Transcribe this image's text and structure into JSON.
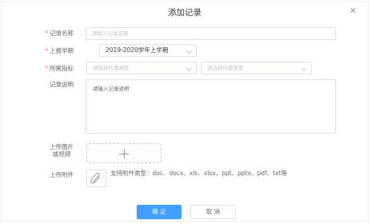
{
  "dialog": {
    "title": "添加记录",
    "close_symbol": "✕"
  },
  "form": {
    "name": {
      "required": "*",
      "label": "记录名称",
      "placeholder": "请输入记录名称"
    },
    "term": {
      "required": "*",
      "label": "上报学期",
      "value": "2019-2020学年上学期"
    },
    "indicator": {
      "required": "*",
      "label": "所属指标",
      "placeholder1": "请选择所属维度",
      "placeholder2": "请选择所属要素"
    },
    "description": {
      "label": "记录说明",
      "placeholder": "请输入记录说明"
    },
    "upload_media": {
      "label_line1": "上传图片",
      "label_line2": "或视频"
    },
    "attachment": {
      "label": "上传附件",
      "hint": "支持附件类型：doc、docx、xls、xlsx、ppt、pptx、pdf、txt等"
    }
  },
  "footer": {
    "confirm": "确 定",
    "cancel": "取 消"
  },
  "icons": {
    "close": "close-icon",
    "plus": "plus-icon",
    "attachment": "paperclip-icon",
    "dropdown": "chevron-down-icon"
  },
  "colors": {
    "primary": "#409eff",
    "required": "#f56c6c",
    "border": "#dcdfe6"
  }
}
